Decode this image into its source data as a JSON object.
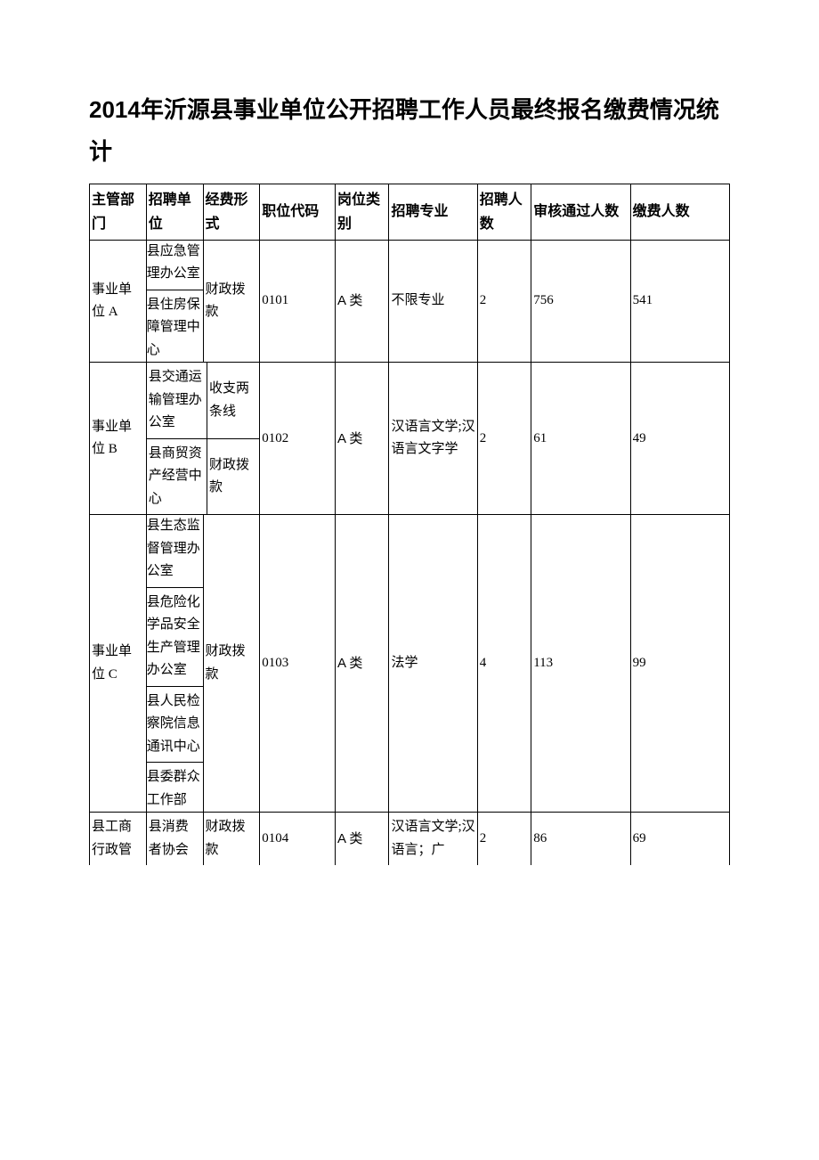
{
  "title": "2014年沂源县事业单位公开招聘工作人员最终报名缴费情况统计",
  "headers": {
    "dept": "主管部门",
    "unit": "招聘单位",
    "fund": "经费形式",
    "code": "职位代码",
    "cat": "岗位类别",
    "major": "招聘专业",
    "qty": "招聘人数",
    "pass": "审核通过人数",
    "pay": "缴费人数"
  },
  "chart_data": {
    "type": "table",
    "columns": [
      "主管部门",
      "招聘单位",
      "经费形式",
      "职位代码",
      "岗位类别",
      "招聘专业",
      "招聘人数",
      "审核通过人数",
      "缴费人数"
    ],
    "rows": [
      {
        "dept": "事业单位 A",
        "units": [
          "县应急管理办公室",
          "县住房保障管理中心"
        ],
        "funds": [
          "财政拨款"
        ],
        "code": "0101",
        "cat": "A 类",
        "major": "不限专业",
        "qty": 2,
        "pass": 756,
        "pay": 541
      },
      {
        "dept": "事业单位 B",
        "units": [
          "县交通运输管理办公室",
          "县商贸资产经营中心"
        ],
        "funds": [
          "收支两条线",
          "财政拨款"
        ],
        "code": "0102",
        "cat": "A 类",
        "major": "汉语言文学;汉语言文字学",
        "qty": 2,
        "pass": 61,
        "pay": 49
      },
      {
        "dept": "事业单位 C",
        "units": [
          "县生态监督管理办公室",
          "县危险化学品安全生产管理办公室",
          "县人民检察院信息通讯中心",
          "县委群众工作部"
        ],
        "funds": [
          "财政拨款"
        ],
        "code": "0103",
        "cat": "A 类",
        "major": "法学",
        "qty": 4,
        "pass": 113,
        "pay": 99
      },
      {
        "dept": "县工商行政管",
        "units": [
          "县消费者协会"
        ],
        "funds": [
          "财政拨款"
        ],
        "code": "0104",
        "cat": "A 类",
        "major": "汉语言文学;汉语言；广",
        "qty": 2,
        "pass": 86,
        "pay": 69
      }
    ]
  },
  "r1": {
    "dept": "事业单位 A",
    "u1": "县应急管理办公室",
    "u2": "县住房保障管理中心",
    "fund": "财政拨款",
    "code": "0101",
    "cat": "A 类",
    "major": "不限专业",
    "qty": "2",
    "pass": "756",
    "pay": "541"
  },
  "r2": {
    "dept": "事业单位 B",
    "u1": "县交通运输管理办公室",
    "u2": "县商贸资产经营中心",
    "f1": "收支两条线",
    "f2": "财政拨款",
    "code": "0102",
    "cat": "A 类",
    "major": "汉语言文学;汉语言文字学",
    "qty": "2",
    "pass": "61",
    "pay": "49"
  },
  "r3": {
    "dept": "事业单位 C",
    "u1": "县生态监督管理办公室",
    "u2": "县危险化学品安全生产管理办公室",
    "u3": "县人民检察院信息通讯中心",
    "u4": "县委群众工作部",
    "fund": "财政拨款",
    "code": "0103",
    "cat": "A 类",
    "major": "法学",
    "qty": "4",
    "pass": "113",
    "pay": "99"
  },
  "r4": {
    "dept": "县工商行政管",
    "u1": "县消费者协会",
    "fund": "财政拨款",
    "code": "0104",
    "cat": "A 类",
    "major": "汉语言文学;汉语言；广",
    "qty": "2",
    "pass": "86",
    "pay": "69"
  }
}
